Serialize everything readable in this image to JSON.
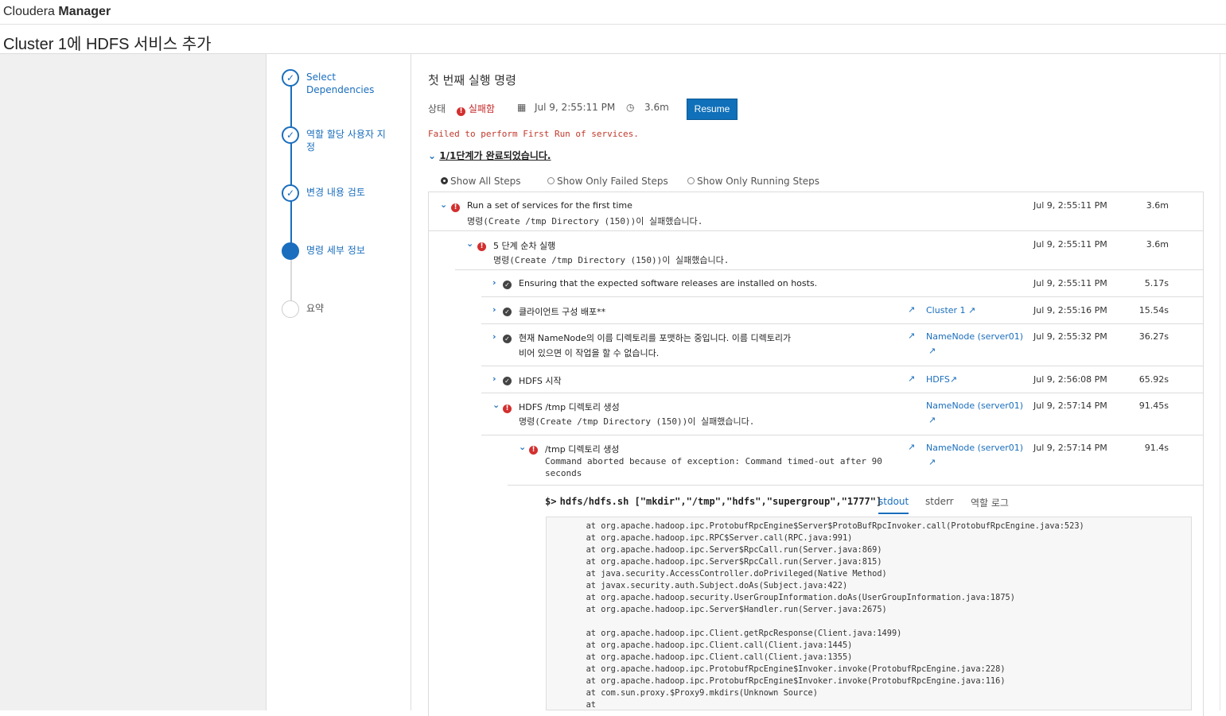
{
  "app": {
    "brand_prefix": "Cloudera ",
    "brand_bold": "Manager"
  },
  "page": {
    "title": "Cluster 1에 HDFS 서비스 추가"
  },
  "wizard": {
    "steps": [
      {
        "label": "Select Dependencies",
        "state": "done"
      },
      {
        "label": "역할 할당 사용자 지정",
        "state": "done"
      },
      {
        "label": "변경 내용 검토",
        "state": "done"
      },
      {
        "label": "명령 세부 정보",
        "state": "active"
      },
      {
        "label": "요약",
        "state": "future"
      }
    ]
  },
  "command": {
    "title": "첫 번째 실행 명령",
    "status_label": "상태",
    "status_value": "실패함",
    "date": "Jul 9, 2:55:11 PM",
    "duration": "3.6m",
    "resume_label": "Resume",
    "failed_message": "Failed to perform First Run of services.",
    "stage_summary": "1/1단계가 완료되었습니다."
  },
  "filters": {
    "all": "Show All Steps",
    "failed": "Show Only Failed Steps",
    "running": "Show Only Running Steps"
  },
  "steps": [
    {
      "name": "Run a set of services for the first time",
      "sub": "명령(Create /tmp Directory (150))이 실패했습니다.",
      "time": "Jul 9, 2:55:11 PM",
      "dur": "3.6m"
    },
    {
      "name": "5 단계 순차 실행",
      "sub": "명령(Create /tmp Directory (150))이 실패했습니다.",
      "time": "Jul 9, 2:55:11 PM",
      "dur": "3.6m"
    },
    {
      "name": "Ensuring that the expected software releases are installed on hosts.",
      "time": "Jul 9, 2:55:11 PM",
      "dur": "5.17s"
    },
    {
      "name": "클라이언트 구성 배포**",
      "link": "Cluster 1",
      "time": "Jul 9, 2:55:16 PM",
      "dur": "15.54s"
    },
    {
      "name": "현재 NameNode의 이름 디렉토리를 포맷하는 중입니다. 이름 디렉토리가",
      "name2": "비어 있으면 이 작업을 할 수 없습니다.",
      "link": "NameNode (server01)",
      "time": "Jul 9, 2:55:32 PM",
      "dur": "36.27s"
    },
    {
      "name": "HDFS 시작",
      "link": "HDFS",
      "time": "Jul 9, 2:56:08 PM",
      "dur": "65.92s"
    },
    {
      "name": "HDFS /tmp 디렉토리 생성",
      "sub": "명령(Create /tmp Directory (150))이 실패했습니다.",
      "link": "NameNode (server01)",
      "time": "Jul 9, 2:57:14 PM",
      "dur": "91.45s"
    },
    {
      "name": "/tmp 디렉토리 생성",
      "sub": "Command aborted because of exception: Command timed-out after 90",
      "sub2": "seconds",
      "link": "NameNode (server01)",
      "time": "Jul 9, 2:57:14 PM",
      "dur": "91.4s"
    }
  ],
  "output": {
    "prompt": "$>",
    "command": "hdfs/hdfs.sh [\"mkdir\",\"/tmp\",\"hdfs\",\"supergroup\",\"1777\"]",
    "tabs": [
      "stdout",
      "stderr",
      "역할 로그"
    ],
    "log": "        at org.apache.hadoop.ipc.ProtobufRpcEngine$Server$ProtoBufRpcInvoker.call(ProtobufRpcEngine.java:523)\n        at org.apache.hadoop.ipc.RPC$Server.call(RPC.java:991)\n        at org.apache.hadoop.ipc.Server$RpcCall.run(Server.java:869)\n        at org.apache.hadoop.ipc.Server$RpcCall.run(Server.java:815)\n        at java.security.AccessController.doPrivileged(Native Method)\n        at javax.security.auth.Subject.doAs(Subject.java:422)\n        at org.apache.hadoop.security.UserGroupInformation.doAs(UserGroupInformation.java:1875)\n        at org.apache.hadoop.ipc.Server$Handler.run(Server.java:2675)\n\n        at org.apache.hadoop.ipc.Client.getRpcResponse(Client.java:1499)\n        at org.apache.hadoop.ipc.Client.call(Client.java:1445)\n        at org.apache.hadoop.ipc.Client.call(Client.java:1355)\n        at org.apache.hadoop.ipc.ProtobufRpcEngine$Invoker.invoke(ProtobufRpcEngine.java:228)\n        at org.apache.hadoop.ipc.ProtobufRpcEngine$Invoker.invoke(ProtobufRpcEngine.java:116)\n        at com.sun.proxy.$Proxy9.mkdirs(Unknown Source)\n        at"
  },
  "colors": {
    "accent": "#1070b9",
    "error": "#d32f2f"
  }
}
